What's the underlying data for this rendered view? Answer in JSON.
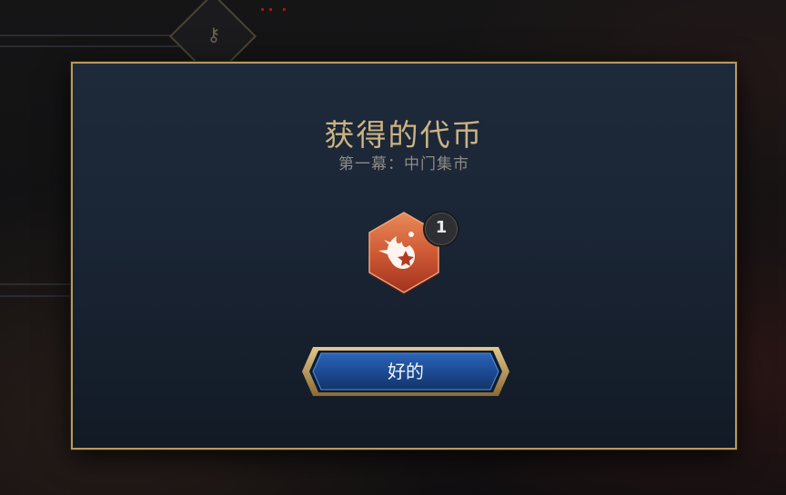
{
  "dialog": {
    "title": "获得的代币",
    "subtitle": "第一幕：中门集市",
    "token": {
      "icon": "flaming-shuriken-icon",
      "count": "1"
    },
    "confirm_label": "好的"
  },
  "colors": {
    "frame_gold": "#b9995d",
    "title_gold": "#cdb382",
    "panel_blue": "#1e2a3a",
    "token_orange": "#d8643a",
    "button_blue": "#1d4b93"
  }
}
